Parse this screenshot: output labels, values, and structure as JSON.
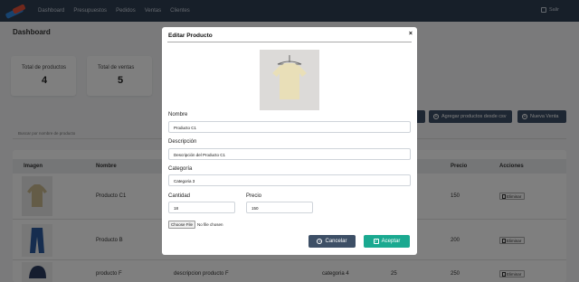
{
  "nav": {
    "links": [
      "Dashboard",
      "Presupuestos",
      "Pedidos",
      "Ventas",
      "Clientes"
    ],
    "logout_label": "Salir"
  },
  "page": {
    "title": "Dashboard",
    "stats": [
      {
        "label": "Total de productos",
        "value": "4"
      },
      {
        "label": "Total de ventas",
        "value": "5"
      }
    ],
    "actions": {
      "add_from_csv": "Agregar productos desde csv",
      "new_sale": "Nueva Venta"
    },
    "search_placeholder": "Buscar por nombre de producto"
  },
  "table": {
    "headers": {
      "imagen": "Imagen",
      "nombre": "Nombre",
      "precio": "Precio",
      "acciones": "Acciones"
    },
    "rows": [
      {
        "nombre": "Producto C1",
        "descripcion": "",
        "categoria": "",
        "cantidad": "",
        "precio": "150",
        "accion": "Eliminar"
      },
      {
        "nombre": "Producto B",
        "descripcion": "",
        "categoria": "",
        "cantidad": "",
        "precio": "200",
        "accion": "Eliminar"
      },
      {
        "nombre": "producto F",
        "descripcion": "descripcion producto F",
        "categoria": "categoria 4",
        "cantidad": "25",
        "precio": "250",
        "accion": "Eliminar"
      }
    ]
  },
  "modal": {
    "title": "Editar Producto",
    "close": "×",
    "fields": {
      "nombre": {
        "label": "Nombre",
        "value": "Producto C1"
      },
      "descripcion": {
        "label": "Descripción",
        "value": "Descripción del Producto C1"
      },
      "categoria": {
        "label": "Categoría",
        "value": "Categoria 3"
      },
      "cantidad": {
        "label": "Cantidad",
        "value": "18"
      },
      "precio": {
        "label": "Precio",
        "value": "150"
      }
    },
    "file": {
      "button": "Choose File",
      "status": "No file chosen"
    },
    "cancel_label": "Cancelar",
    "accept_label": "Aceptar"
  },
  "colors": {
    "navbar": "#2f3e52",
    "accept": "#1aa990",
    "cancel": "#3d4f66"
  }
}
